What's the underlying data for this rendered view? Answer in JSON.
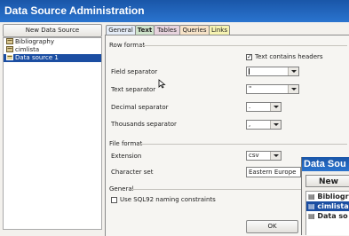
{
  "window": {
    "title": "Data Source Administration"
  },
  "sidebar": {
    "new_button": "New Data Source",
    "items": [
      {
        "label": "Bibliography",
        "selected": false
      },
      {
        "label": "cimlista",
        "selected": false
      },
      {
        "label": "Data source 1",
        "selected": true
      }
    ]
  },
  "tabs": [
    {
      "label": "General",
      "active": false
    },
    {
      "label": "Text",
      "active": true
    },
    {
      "label": "Tables",
      "active": false
    },
    {
      "label": "Queries",
      "active": false
    },
    {
      "label": "Links",
      "active": false
    }
  ],
  "row_format": {
    "title": "Row format",
    "contains_headers_label": "Text contains headers",
    "contains_headers_checked": true,
    "field_separator_label": "Field separator",
    "field_separator_value": "",
    "text_separator_label": "Text separator",
    "text_separator_value": "\"",
    "decimal_separator_label": "Decimal separator",
    "decimal_separator_value": ".",
    "thousands_separator_label": "Thousands separator",
    "thousands_separator_value": ","
  },
  "file_format": {
    "title": "File format",
    "extension_label": "Extension",
    "extension_value": "csv",
    "charset_label": "Character set",
    "charset_value": "Eastern Europe"
  },
  "general": {
    "title": "General",
    "sql92_label": "Use SQL92 naming constraints",
    "sql92_checked": false
  },
  "ok_button": "OK",
  "second_window": {
    "title": "Data Sou",
    "new_button": "New",
    "items": [
      {
        "label": "Bibliogr",
        "selected": false
      },
      {
        "label": "cimlista",
        "selected": true
      },
      {
        "label": "Data so",
        "selected": false
      }
    ]
  },
  "colors": {
    "titlebar": "#1a56a8",
    "selection": "#1b4ea2"
  }
}
